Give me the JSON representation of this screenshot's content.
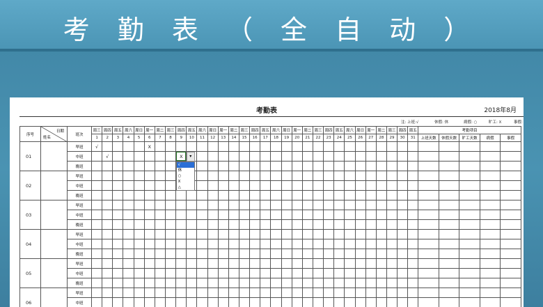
{
  "banner": {
    "title": "考 勤 表 （ 全 自 动 ）"
  },
  "sheet": {
    "title": "考勤表",
    "date": "2018年8月",
    "legend": [
      "注:  上班:√",
      "休假:  休",
      "病假:  ○",
      "旷工:  X",
      "事假:  △"
    ],
    "headers": {
      "no": "序号",
      "diag_top": "日期",
      "diag_bottom": "姓名",
      "shift": "班次",
      "summary": "考勤项目",
      "summary_cols": [
        "上班天数",
        "休假天数",
        "旷工天数",
        "病假",
        "事假"
      ]
    },
    "weekdays": [
      "周三",
      "周四",
      "周五",
      "周六",
      "周日",
      "周一",
      "周二",
      "周三",
      "周四",
      "周五",
      "周六",
      "周日",
      "周一",
      "周二",
      "周三",
      "周四",
      "周五",
      "周六",
      "周日",
      "周一",
      "周二",
      "周三",
      "周四",
      "周五",
      "周六",
      "周日",
      "周一",
      "周二",
      "周三",
      "周四",
      "周五"
    ],
    "days": [
      "1",
      "2",
      "3",
      "4",
      "5",
      "6",
      "7",
      "8",
      "9",
      "10",
      "11",
      "12",
      "13",
      "14",
      "15",
      "16",
      "17",
      "18",
      "19",
      "20",
      "21",
      "22",
      "23",
      "24",
      "25",
      "26",
      "27",
      "28",
      "29",
      "30",
      "31"
    ],
    "shifts": [
      "早班",
      "中班",
      "晚班"
    ],
    "employees": [
      {
        "no": "01"
      },
      {
        "no": "02"
      },
      {
        "no": "03"
      },
      {
        "no": "04"
      },
      {
        "no": "05"
      },
      {
        "no": "06"
      }
    ],
    "marks": [
      {
        "emp": 0,
        "shift": 0,
        "day": 1,
        "text": "√"
      },
      {
        "emp": 0,
        "shift": 0,
        "day": 6,
        "text": "X"
      },
      {
        "emp": 0,
        "shift": 1,
        "day": 2,
        "text": "√"
      }
    ],
    "dropdown": {
      "emp": 0,
      "shift": 1,
      "day": 9,
      "value": "X",
      "arrow": "▾",
      "options": [
        "√",
        "休",
        "○",
        "X",
        "△"
      ],
      "selected_index": 0
    }
  }
}
